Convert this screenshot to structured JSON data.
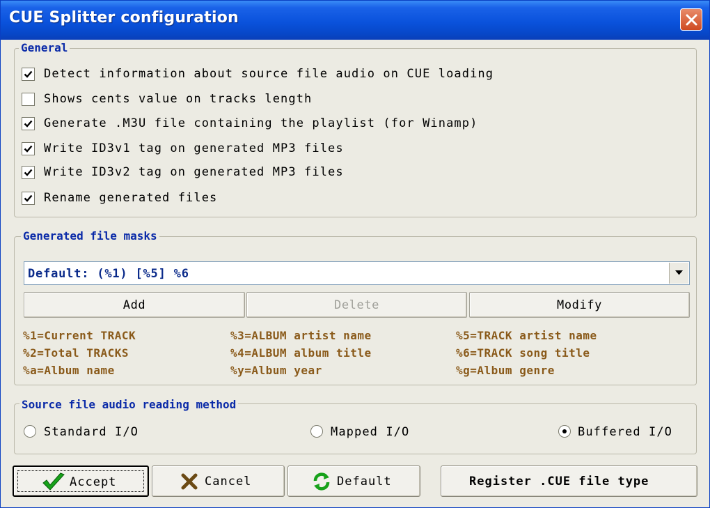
{
  "window": {
    "title": "CUE Splitter configuration",
    "close_icon": "close-icon"
  },
  "general": {
    "legend": "General",
    "options": [
      {
        "label": "Detect information about source file audio on CUE loading",
        "checked": true
      },
      {
        "label": "Shows cents value on tracks length",
        "checked": false
      },
      {
        "label": "Generate .M3U file containing the playlist (for Winamp)",
        "checked": true
      },
      {
        "label": "Write ID3v1 tag on generated MP3 files",
        "checked": true
      },
      {
        "label": "Write ID3v2 tag on generated MP3 files",
        "checked": true
      },
      {
        "label": "Rename generated files",
        "checked": true
      }
    ]
  },
  "masks": {
    "legend": "Generated file masks",
    "selected": "Default: (%1) [%5] %6",
    "add_label": "Add",
    "delete_label": "Delete",
    "modify_label": "Modify",
    "legend_items": [
      "%1=Current TRACK",
      "%3=ALBUM artist name",
      "%5=TRACK artist name",
      "%2=Total TRACKS",
      "%4=ALBUM album title",
      "%6=TRACK song title",
      "%a=Album name",
      "%y=Album year",
      "%g=Album genre"
    ]
  },
  "reading": {
    "legend": "Source file audio reading method",
    "options": [
      {
        "label": "Standard I/O",
        "selected": false
      },
      {
        "label": "Mapped I/O",
        "selected": false
      },
      {
        "label": "Buffered I/O",
        "selected": true
      }
    ]
  },
  "footer": {
    "accept_label": "Accept",
    "cancel_label": "Cancel",
    "default_label": "Default",
    "register_label": "Register .CUE file type"
  },
  "colors": {
    "title_bar": "#0a52dc",
    "legend": "#0a2aa8",
    "mask_text": "#8a5a1a",
    "face": "#ecebe3"
  }
}
